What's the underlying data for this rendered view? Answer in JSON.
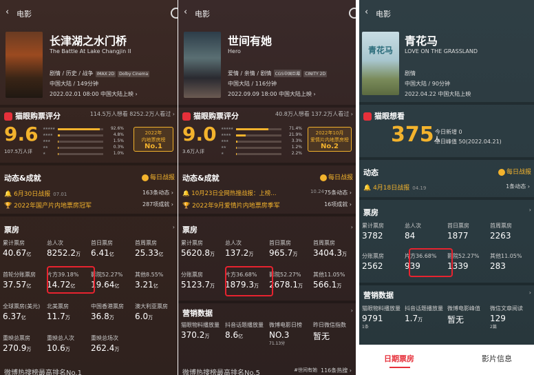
{
  "p1": {
    "nav_title": "电影",
    "title": "长津湖之水门桥",
    "en": "The Battle At Lake Changjin II",
    "genre": "剧情 / 历史 / 战争",
    "tag1": "IMAX 2D",
    "tag2": "Dolby Cinema",
    "region": "中国大陆 / 149分钟",
    "release": "2022.02.01 08:00 中国大陆上映 ›",
    "score_hd": "猫眼购票评分",
    "score_meta": "114.5万人想看 8252.2万人看过 ›",
    "score": "9.6",
    "score_cnt": "107.5万人评",
    "pcts": [
      "92.6%",
      "4.8%",
      "1.5%",
      "0.3%",
      "1.0%"
    ],
    "pct_vals": [
      92.6,
      4.8,
      1.5,
      0.3,
      1.0
    ],
    "rank1": "2022年",
    "rank2": "内地票房榜",
    "rank3": "No.1",
    "dyn_hd": "动态&成就",
    "dyn_btn": "每日战报",
    "l1": "6月30日战报",
    "l1m": "07.01",
    "l1c": "163条动态 ›",
    "l2": "2022年国产片内地票房冠军",
    "l2c": "287项成就 ›",
    "bo_hd": "票房",
    "c": [
      [
        "累计票房",
        "40.67",
        "亿"
      ],
      [
        "总人次",
        "8252.2",
        "万"
      ],
      [
        "首日票房",
        "6.41",
        "亿"
      ],
      [
        "首周票房",
        "25.33",
        "亿"
      ],
      [
        "首轮分账票房",
        "37.57",
        "亿"
      ],
      [
        "片方39.18%",
        "14.72",
        "亿"
      ],
      [
        "影院52.27%",
        "19.64",
        "亿"
      ],
      [
        "其他8.55%",
        "3.21",
        "亿"
      ],
      [
        "全球票房(美元)",
        "6.37",
        "亿"
      ],
      [
        "北美票房",
        "11.7",
        "万"
      ],
      [
        "中国香港票房",
        "36.8",
        "万"
      ],
      [
        "澳大利亚票房",
        "6.0",
        "万"
      ],
      [
        "重映总票房",
        "270.9",
        "万"
      ],
      [
        "重映总人次",
        "10.6",
        "万"
      ],
      [
        "重映总场次",
        "262.4",
        "万"
      ],
      [
        "",
        "",
        ""
      ]
    ],
    "bottom": "微博热搜榜最高排名No.1"
  },
  "p2": {
    "nav_title": "电影",
    "title": "世间有她",
    "en": "Hero",
    "genre": "爱情 / 亲情 / 剧情",
    "tag1": "CGS中国巨幕",
    "tag2": "CINITY 2D",
    "region": "中国大陆 / 116分钟",
    "release": "2022.09.09 18:00 中国大陆上映 ›",
    "score_hd": "猫眼购票评分",
    "score_meta": "40.8万人想看 137.2万人看过 ›",
    "score": "9.0",
    "score_cnt": "3.6万人评",
    "pcts": [
      "71.4%",
      "21.9%",
      "3.3%",
      "1.2%",
      "2.2%"
    ],
    "pct_vals": [
      71.4,
      21.9,
      3.3,
      1.2,
      2.2
    ],
    "rank1": "2022年10月",
    "rank2": "爱情片内地票房榜",
    "rank3": "No.2",
    "dyn_hd": "动态&成就",
    "dyn_btn": "每日战报",
    "l1": "10月23日全网热搜战报：上榜...",
    "l1m": "10.24",
    "l1c": "75条动态 ›",
    "l2": "2022年9月爱情片内地票房季军",
    "l2c": "16项成就 ›",
    "bo_hd": "票房",
    "c": [
      [
        "累计票房",
        "5620.8",
        "万"
      ],
      [
        "总人次",
        "137.2",
        "万"
      ],
      [
        "首日票房",
        "965.7",
        "万"
      ],
      [
        "首周票房",
        "3404.3",
        "万"
      ],
      [
        "分账票房",
        "5123.7",
        "万"
      ],
      [
        "片方36.68%",
        "1879.3",
        "万"
      ],
      [
        "影院52.27%",
        "2678.1",
        "万"
      ],
      [
        "其他11.05%",
        "566.1",
        "万"
      ]
    ],
    "mk_hd": "营销数据",
    "m": [
      [
        "猫眼物料播放量",
        "370.2",
        "万",
        ""
      ],
      [
        "抖音话题播放量",
        "8.6",
        "亿",
        ""
      ],
      [
        "微博电影日榜",
        "NO.3",
        "",
        "71.13分"
      ],
      [
        "昨日微信指数",
        "暂无",
        "",
        ""
      ]
    ],
    "bottom": "微博热搜榜最高排名No.5",
    "bottom2": "116条热搜 ›",
    "bottom3": "#世间有她"
  },
  "p3": {
    "nav_title": "电影",
    "title": "青花马",
    "en": "LOVE ON THE GRASSLAND",
    "poster_text": "青花马",
    "genre": "剧情",
    "region": "中国大陆 / 90分钟",
    "release": "2022.04.22 中国大陆上映",
    "want_hd": "猫眼想看",
    "want": "375",
    "want_unit": "人",
    "today": "今日新增",
    "today_v": "0",
    "peak": "单日峰值",
    "peak_v": "50(2022.04.21)",
    "dyn_hd": "动态",
    "dyn_btn": "每日战报",
    "l1": "4月18日战报",
    "l1m": "04.19",
    "l1c": "1条动态 ›",
    "bo_hd": "票房",
    "c": [
      [
        "累计票房",
        "3782",
        ""
      ],
      [
        "总人次",
        "84",
        ""
      ],
      [
        "首日票房",
        "1877",
        ""
      ],
      [
        "首周票房",
        "2263",
        ""
      ],
      [
        "分账票房",
        "2562",
        ""
      ],
      [
        "片方36.68%",
        "939",
        ""
      ],
      [
        "影院52.27%",
        "1339",
        ""
      ],
      [
        "其他11.05%",
        "283",
        ""
      ]
    ],
    "mk_hd": "营销数据",
    "m": [
      [
        "猫眼物料播放量",
        "9791",
        "",
        "1条"
      ],
      [
        "抖音话题播放量",
        "1.7",
        "万",
        ""
      ],
      [
        "微博电影峰值",
        "暂无",
        "",
        ""
      ],
      [
        "微信文章阅读",
        "129",
        "",
        "2篇"
      ]
    ],
    "tab1": "日期票房",
    "tab2": "影片信息"
  }
}
